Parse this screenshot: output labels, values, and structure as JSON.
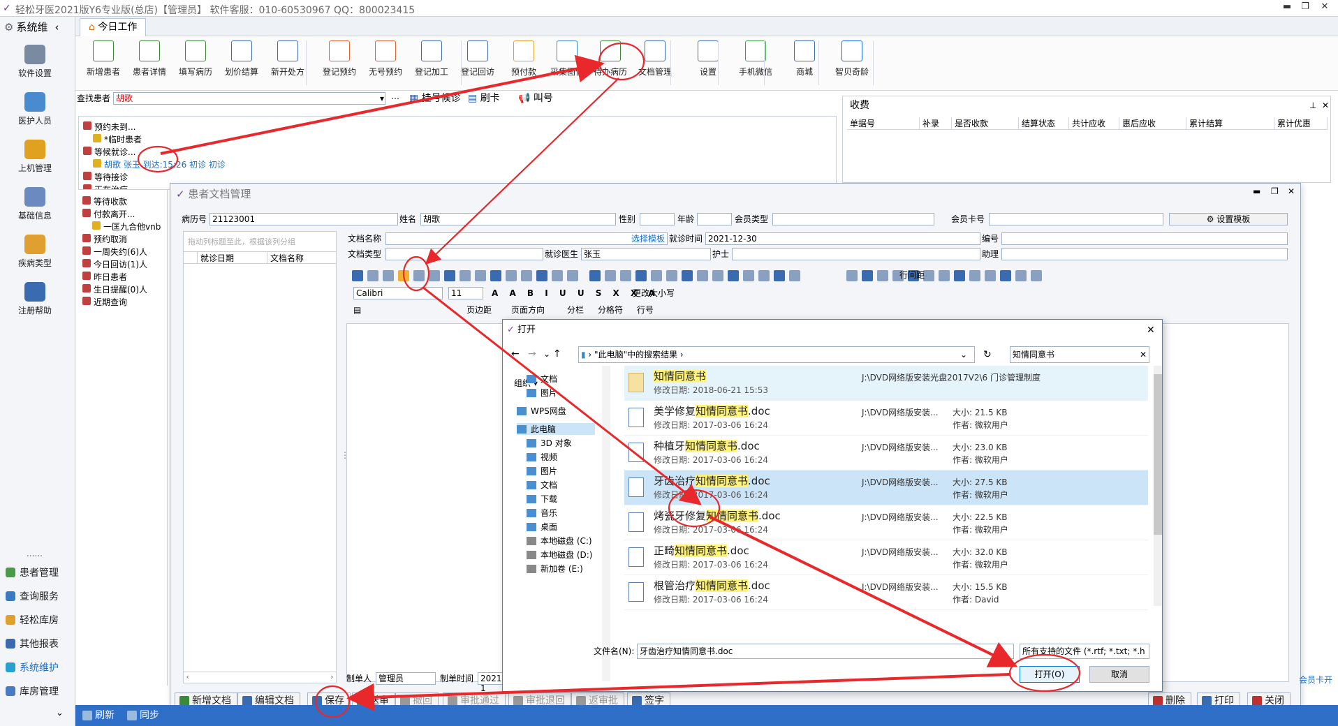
{
  "app": {
    "title": "轻松牙医2021版Y6专业版(总店)【管理员】   软件客服：010-60530967 QQ：800023415"
  },
  "left_nav": {
    "header": "系统维",
    "items": [
      {
        "label": "软件设置",
        "color": "#7a8aa0"
      },
      {
        "label": "医护人员",
        "color": "#4a8bd0"
      },
      {
        "label": "上机管理",
        "color": "#e0a020"
      },
      {
        "label": "基础信息",
        "color": "#6a8ac0"
      },
      {
        "label": "疾病类型",
        "color": "#e0a030"
      },
      {
        "label": "注册帮助",
        "color": "#3a6ab0"
      }
    ],
    "dots": "......",
    "lower": [
      {
        "label": "患者管理",
        "color": "#4a9a4a"
      },
      {
        "label": "查询服务",
        "color": "#3a7ac0"
      },
      {
        "label": "轻松库房",
        "color": "#e0a030"
      },
      {
        "label": "其他报表",
        "color": "#3a6ab0"
      },
      {
        "label": "系统维护",
        "color": "#2aa0d0",
        "active": true
      },
      {
        "label": "库房管理",
        "color": "#4a7ac0"
      }
    ]
  },
  "tab": {
    "label": "今日工作"
  },
  "ribbon": [
    {
      "label": "新增患者",
      "color": "#3a8a3a"
    },
    {
      "label": "患者详情",
      "color": "#3a8a3a"
    },
    {
      "label": "填写病历",
      "color": "#3a8a3a"
    },
    {
      "label": "划价结算",
      "color": "#3a6ab0"
    },
    {
      "label": "新开处方",
      "color": "#3a6ab0"
    },
    {
      "label": "登记预约",
      "color": "#e06030"
    },
    {
      "label": "无号预约",
      "color": "#e06030"
    },
    {
      "label": "登记加工",
      "color": "#3a6ab0"
    },
    {
      "label": "登记回访",
      "color": "#3a6ab0"
    },
    {
      "label": "预付款",
      "color": "#e0a030"
    },
    {
      "label": "采集图像",
      "color": "#3a8ac0"
    },
    {
      "label": "待办病历",
      "color": "#3a8a3a"
    },
    {
      "label": "文档管理",
      "color": "#3a6ab0"
    },
    {
      "label": "设置",
      "color": "#3a6ab0"
    },
    {
      "label": "手机微信",
      "color": "#3aa040"
    },
    {
      "label": "商城",
      "color": "#3a6ab0"
    },
    {
      "label": "智贝奇龄",
      "color": "#1a6ae0"
    }
  ],
  "search": {
    "label": "查找患者",
    "value": "胡歌",
    "queue_btn": "挂号候诊",
    "card_btn": "刷卡",
    "call_btn": "叫号"
  },
  "tree": [
    {
      "text": "预约未到...",
      "indent": 0
    },
    {
      "text": "*临时患者",
      "indent": 1
    },
    {
      "text": "等候就诊...",
      "indent": 0
    },
    {
      "text": "胡歌  张玉  到达:15:26  初诊  初诊",
      "indent": 1,
      "selected": true
    },
    {
      "text": "等待接诊",
      "indent": 0
    },
    {
      "text": "正在治疗",
      "indent": 0
    },
    {
      "text": "等待收款",
      "indent": 0
    },
    {
      "text": "付款离开...",
      "indent": 0
    },
    {
      "text": "一匡九合他vnb",
      "indent": 1
    },
    {
      "text": "预约取消",
      "indent": 0
    },
    {
      "text": "一周失约(6)人",
      "indent": 0
    },
    {
      "text": "今日回访(1)人",
      "indent": 0
    },
    {
      "text": "昨日患者",
      "indent": 0
    },
    {
      "text": "生日提醒(0)人",
      "indent": 0
    },
    {
      "text": "近期查询",
      "indent": 0
    }
  ],
  "fee": {
    "title": "收费",
    "columns": [
      "单据号",
      "补录",
      "是否收款",
      "结算状态",
      "共计应收",
      "惠后应收",
      "累计结算",
      "累计优惠"
    ]
  },
  "docwin": {
    "title": "患者文档管理",
    "fields": {
      "record_no_label": "病历号",
      "record_no": "21123001",
      "name_label": "姓名",
      "name": "胡歌",
      "sex_label": "性别",
      "age_label": "年龄",
      "member_type_label": "会员类型",
      "member_card_label": "会员卡号",
      "template_btn": "设置模板",
      "doc_name_label": "文档名称",
      "select_template": "选择模板",
      "visit_time_label": "就诊时间",
      "visit_time": "2021-12-30",
      "no_label": "编号",
      "doc_type_label": "文档类型",
      "doctor_label": "就诊医生",
      "doctor": "张玉",
      "nurse_label": "护士",
      "assistant_label": "助理",
      "maker_label": "制单人",
      "maker": "管理员",
      "make_time_label": "制单时间",
      "make_time": "2021-1"
    },
    "list": {
      "group_hint": "拖动列标题至此，根据该列分组",
      "col1": "就诊日期",
      "col2": "文档名称"
    },
    "toolbar": {
      "font": "Calibri",
      "size": "11",
      "row_spacing": "行间距",
      "change_case": "更改大小写",
      "page_margin": "页边距",
      "orientation": "页面方向",
      "columns": "分栏",
      "divider": "分格符",
      "line_no": "行号"
    },
    "member_card_open": "会员卡开",
    "buttons": [
      "新增文档",
      "编辑文档",
      "保存",
      "送审",
      "撤回",
      "审批通过",
      "审批退回",
      "返审批",
      "签字",
      "删除",
      "打印",
      "关闭"
    ]
  },
  "dialog": {
    "title": "打开",
    "path": "\"此电脑\"中的搜索结果",
    "search_value": "知情同意书",
    "organize": "组织",
    "nav": [
      "文档",
      "图片",
      "WPS网盘",
      "此电脑",
      "3D 对象",
      "视频",
      "图片",
      "文档",
      "下载",
      "音乐",
      "桌面",
      "本地磁盘 (C:)",
      "本地磁盘 (D:)",
      "新加卷 (E:)"
    ],
    "files": [
      {
        "name": "知情同意书",
        "date": "修改日期: 2018-06-21 15:53",
        "path": "J:\\DVD网络版安装光盘2017V2\\6 门诊管理制度",
        "size": "",
        "author": "",
        "folder": true
      },
      {
        "name": "美学修复知情同意书.doc",
        "date": "修改日期: 2017-03-06 16:24",
        "path": "J:\\DVD网络版安装...",
        "size": "大小: 21.5 KB",
        "author": "作者: 微软用户"
      },
      {
        "name": "种植牙知情同意书.doc",
        "date": "修改日期: 2017-03-06 16:24",
        "path": "J:\\DVD网络版安装...",
        "size": "大小: 23.0 KB",
        "author": "作者: 微软用户"
      },
      {
        "name": "牙齿治疗知情同意书.doc",
        "date": "修改日期: 2017-03-06 16:24",
        "path": "J:\\DVD网络版安装...",
        "size": "大小: 27.5 KB",
        "author": "作者: 微软用户",
        "selected": true
      },
      {
        "name": "烤瓷牙修复知情同意书.doc",
        "date": "修改日期: 2017-03-06 16:24",
        "path": "J:\\DVD网络版安装...",
        "size": "大小: 22.5 KB",
        "author": "作者: 微软用户"
      },
      {
        "name": "正畸知情同意书.doc",
        "date": "修改日期: 2017-03-06 16:24",
        "path": "J:\\DVD网络版安装...",
        "size": "大小: 32.0 KB",
        "author": "作者: 微软用户"
      },
      {
        "name": "根管治疗知情同意书.doc",
        "date": "修改日期: 2017-03-06 16:24",
        "path": "J:\\DVD网络版安装...",
        "size": "大小: 15.5 KB",
        "author": "作者: David"
      }
    ],
    "filename_label": "文件名(N):",
    "filename": "牙齿治疗知情同意书.doc",
    "filter": "所有支持的文件 (*.rtf; *.txt; *.h",
    "open_btn": "打开(O)",
    "cancel_btn": "取消"
  },
  "statusbar": {
    "refresh": "刷新",
    "sync": "同步"
  },
  "colors": {
    "annotation": "#e8282b",
    "accent": "#2f6fc7"
  }
}
